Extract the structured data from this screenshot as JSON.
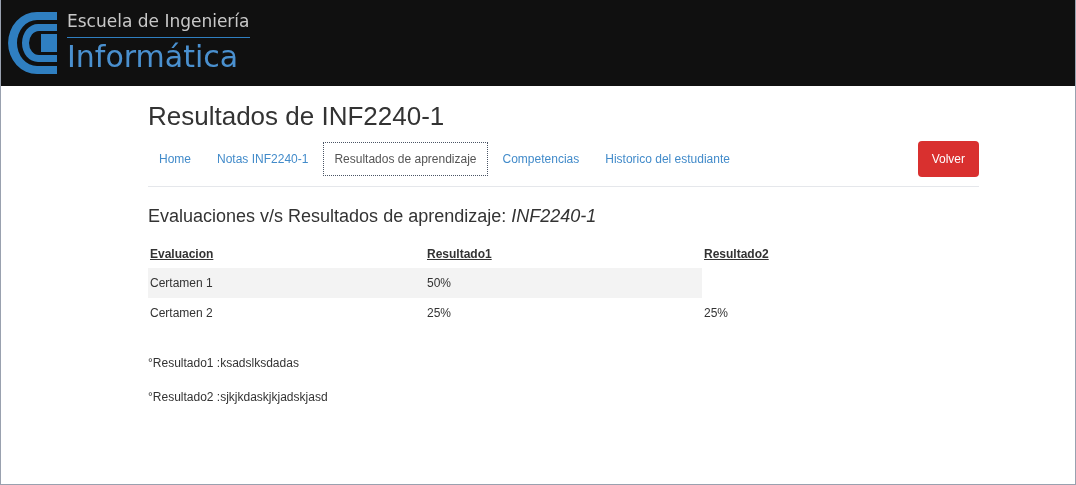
{
  "header": {
    "logo_top": "Escuela de Ingeniería",
    "logo_bottom": "Informática"
  },
  "page_title": "Resultados de INF2240-1",
  "tabs": [
    {
      "label": "Home",
      "selected": false
    },
    {
      "label": "Notas INF2240-1",
      "selected": false
    },
    {
      "label": "Resultados de aprendizaje",
      "selected": true
    },
    {
      "label": "Competencias",
      "selected": false
    },
    {
      "label": "Historico del estudiante",
      "selected": false
    }
  ],
  "back_button": "Volver",
  "section_title": "Evaluaciones v/s Resultados de aprendizaje: *INF2240-1*",
  "table": {
    "columns": [
      "Evaluacion",
      "Resultado1",
      "Resultado2"
    ],
    "rows": [
      [
        "Certamen 1",
        "50%",
        null
      ],
      [
        "Certamen 2",
        "25%",
        "25%"
      ]
    ]
  },
  "footnotes": [
    "°Resultado1 :ksadslksdadas",
    "°Resultado2 :sjkjkdaskjkjadskjasd"
  ]
}
